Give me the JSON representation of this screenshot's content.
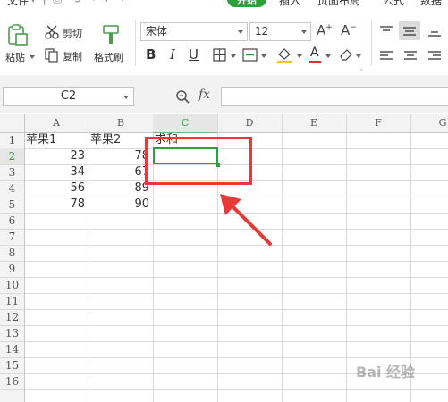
{
  "ribbon": {
    "top_tabs": [
      "文件",
      "开始",
      "插入",
      "页面布局",
      "公式",
      "数据"
    ],
    "active_tab": "开始",
    "cut_label": "剪切",
    "copy_label": "复制",
    "paste_label": "粘贴",
    "format_painter_label": "格式刷",
    "font_name": "宋体",
    "font_size": "12",
    "font_color": "#e03030",
    "fill_color": "#f5c518",
    "accent_color": "#2ca03a"
  },
  "formula_bar": {
    "name_box": "C2",
    "fx_label": "fx",
    "formula": ""
  },
  "sheet": {
    "columns": [
      "A",
      "B",
      "C",
      "D",
      "E",
      "F",
      "G"
    ],
    "rows": [
      "1",
      "2",
      "3",
      "4",
      "5",
      "6",
      "7",
      "8",
      "9",
      "10",
      "11",
      "12",
      "13",
      "14",
      "15",
      "16"
    ],
    "selected_cell": "C2",
    "headers": {
      "a1": "苹果1",
      "b1": "苹果2",
      "c1": "求和"
    },
    "data": [
      {
        "row": "2",
        "a": "23",
        "b": "78"
      },
      {
        "row": "3",
        "a": "34",
        "b": "67"
      },
      {
        "row": "4",
        "a": "56",
        "b": "89"
      },
      {
        "row": "5",
        "a": "78",
        "b": "90"
      }
    ]
  },
  "annotation": {
    "box_color": "#e8393a"
  },
  "watermark": {
    "text": "Bai 经验"
  }
}
